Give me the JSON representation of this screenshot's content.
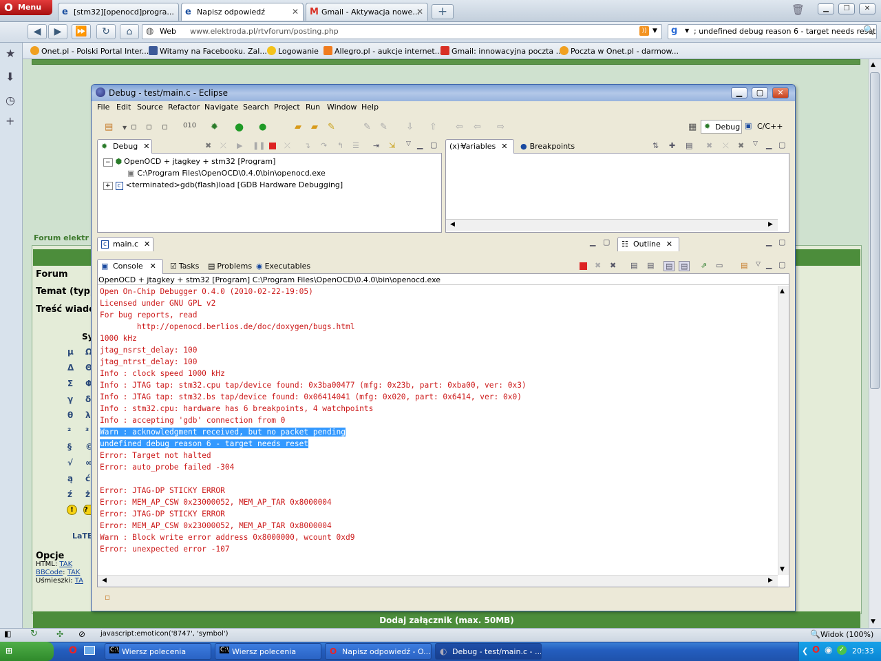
{
  "browser": {
    "menu_label": "Menu",
    "tabs": [
      {
        "label": "[stm32][openocd]progra..."
      },
      {
        "label": "Napisz odpowiedź"
      },
      {
        "label": "Gmail - Aktywacja nowe..."
      }
    ],
    "new_tab_label": "+",
    "web_label": "Web",
    "url": "www.elektroda.pl/rtvforum/posting.php",
    "search_value": "; undefined debug reason 6 - target needs reset",
    "bookmarks": [
      {
        "label": "Onet.pl - Polski Portal Inter...",
        "color": "#f0a020"
      },
      {
        "label": "Witamy na Facebooku. Zal...",
        "color": "#3b5998"
      },
      {
        "label": "Logowanie",
        "color": "#f3c21b"
      },
      {
        "label": "Allegro.pl - aukcje internet...",
        "color": "#f07c1e"
      },
      {
        "label": "Gmail: innowacyjna poczta ...",
        "color": "#d93025"
      },
      {
        "label": "Poczta w Onet.pl - darmow...",
        "color": "#f0a020"
      }
    ],
    "status_text": "javascript:emoticon('8747', 'symbol')",
    "zoom_label": "Widok (100%)"
  },
  "webpage": {
    "forum_label": "Forum elektr",
    "labels": {
      "forum": "Forum",
      "temat": "Temat (typ,",
      "tresc": "Treść wiado"
    },
    "sym_label": "Sy",
    "symbols": [
      [
        "µ",
        "Ω"
      ],
      [
        "Δ",
        "Θ"
      ],
      [
        "Σ",
        "Φ"
      ],
      [
        "γ",
        "δ"
      ],
      [
        "θ",
        "λ"
      ],
      [
        "²",
        "³"
      ],
      [
        "§",
        "©"
      ],
      [
        "√",
        "∞"
      ],
      [
        "ą",
        "ć"
      ],
      [
        "ź",
        "ż"
      ]
    ],
    "latex_label": "LaTE",
    "options_title": "Opcje",
    "opt_html": "HTML:",
    "opt_html_val": "TAK",
    "opt_bbcode": "BBCode",
    "opt_bbcode_val": "TAK",
    "opt_smileys": "Uśmieszki:",
    "opt_smileys_val": "TA",
    "add_attachment": "Dodaj załącznik (max. 50MB)"
  },
  "eclipse": {
    "title": "Debug - test/main.c - Eclipse",
    "menu": [
      "File",
      "Edit",
      "Source",
      "Refactor",
      "Navigate",
      "Search",
      "Project",
      "Run",
      "Window",
      "Help"
    ],
    "perspective_debug": "Debug",
    "perspective_cc": "C/C++",
    "debug_tab": "Debug",
    "tree": {
      "launch": "OpenOCD + jtagkey + stm32 [Program]",
      "process": "C:\\Program Files\\OpenOCD\\0.4.0\\bin\\openocd.exe",
      "terminated": "<terminated>gdb(flash)load [GDB Hardware Debugging]"
    },
    "variables_tab": "Variables",
    "breakpoints_tab": "Breakpoints",
    "editor_tab": "main.c",
    "outline_tab": "Outline",
    "console_tabs": [
      "Console",
      "Tasks",
      "Problems",
      "Executables"
    ],
    "console_header": "OpenOCD + jtagkey + stm32 [Program] C:\\Program Files\\OpenOCD\\0.4.0\\bin\\openocd.exe",
    "console_lines": [
      "Open On-Chip Debugger 0.4.0 (2010-02-22-19:05)",
      "Licensed under GNU GPL v2",
      "For bug reports, read",
      "        http://openocd.berlios.de/doc/doxygen/bugs.html",
      "1000 kHz",
      "jtag_nsrst_delay: 100",
      "jtag_ntrst_delay: 100",
      "Info : clock speed 1000 kHz",
      "Info : JTAG tap: stm32.cpu tap/device found: 0x3ba00477 (mfg: 0x23b, part: 0xba00, ver: 0x3)",
      "Info : JTAG tap: stm32.bs tap/device found: 0x06414041 (mfg: 0x020, part: 0x6414, ver: 0x0)",
      "Info : stm32.cpu: hardware has 6 breakpoints, 4 watchpoints",
      "Info : accepting 'gdb' connection from 0",
      "Warn : acknowledgment received, but no packet pending",
      "undefined debug reason 6 - target needs reset",
      "Error: Target not halted",
      "Error: auto_probe failed -304",
      "",
      "Error: JTAG-DP STICKY ERROR",
      "Error: MEM_AP_CSW 0x23000052, MEM_AP_TAR 0x8000004",
      "Error: JTAG-DP STICKY ERROR",
      "Error: MEM_AP_CSW 0x23000052, MEM_AP_TAR 0x8000004",
      "Warn : Block write error address 0x8000000, wcount 0xd9",
      "Error: unexpected error -107"
    ]
  },
  "taskbar": {
    "start": "start",
    "buttons": [
      {
        "label": "Wiersz polecenia"
      },
      {
        "label": "Wiersz polecenia"
      },
      {
        "label": "Napisz odpowiedź - O..."
      },
      {
        "label": "Debug - test/main.c - ..."
      }
    ],
    "clock": "20:33"
  }
}
